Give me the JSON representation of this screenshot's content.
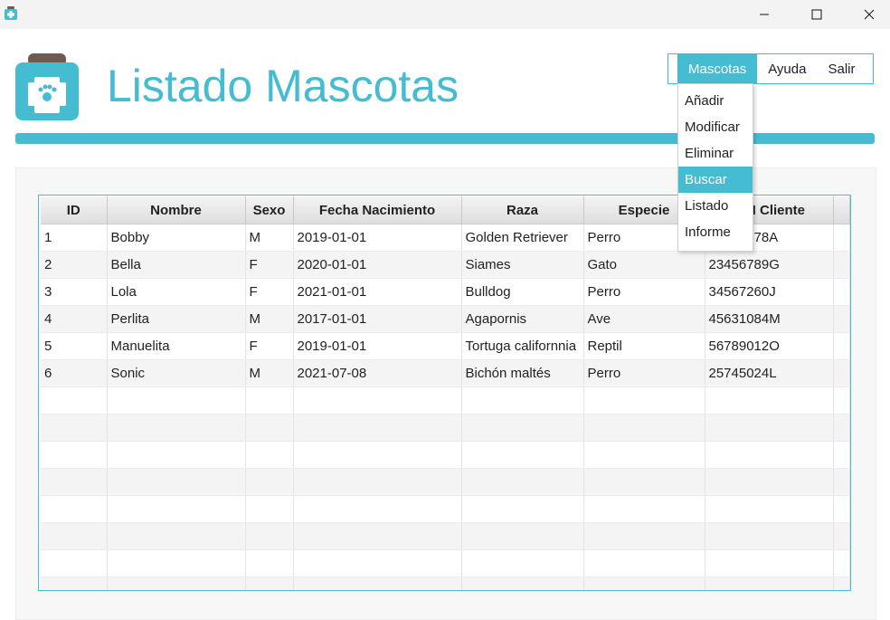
{
  "window": {
    "minimize_glyph": "─",
    "maximize_glyph": "☐",
    "close_glyph": "✕"
  },
  "header": {
    "title": "Listado Mascotas"
  },
  "menu": {
    "items": [
      "Mascotas",
      "Ayuda",
      "Salir"
    ],
    "dropdown": [
      "Añadir",
      "Modificar",
      "Eliminar",
      "Buscar",
      "Listado",
      "Informe"
    ]
  },
  "table": {
    "columns": [
      "ID",
      "Nombre",
      "Sexo",
      "Fecha Nacimiento",
      "Raza",
      "Especie",
      "DNI Cliente"
    ],
    "rows": [
      [
        "1",
        "Bobby",
        "M",
        "2019-01-01",
        "Golden Retriever",
        "Perro",
        "12345678A"
      ],
      [
        "2",
        "Bella",
        "F",
        "2020-01-01",
        "Siames",
        "Gato",
        "23456789G"
      ],
      [
        "3",
        "Lola",
        "F",
        "2021-01-01",
        "Bulldog",
        "Perro",
        "34567260J"
      ],
      [
        "4",
        "Perlita",
        "M",
        "2017-01-01",
        "Agapornis",
        "Ave",
        "45631084M"
      ],
      [
        "5",
        "Manuelita",
        "F",
        "2019-01-01",
        "Tortuga californnia",
        "Reptil",
        "56789012O"
      ],
      [
        "6",
        "Sonic",
        "M",
        "2021-07-08",
        "Bichón maltés",
        "Perro",
        "25745024L"
      ]
    ]
  },
  "colors": {
    "accent": "#45bcd1",
    "lid": "#6f5b55"
  }
}
